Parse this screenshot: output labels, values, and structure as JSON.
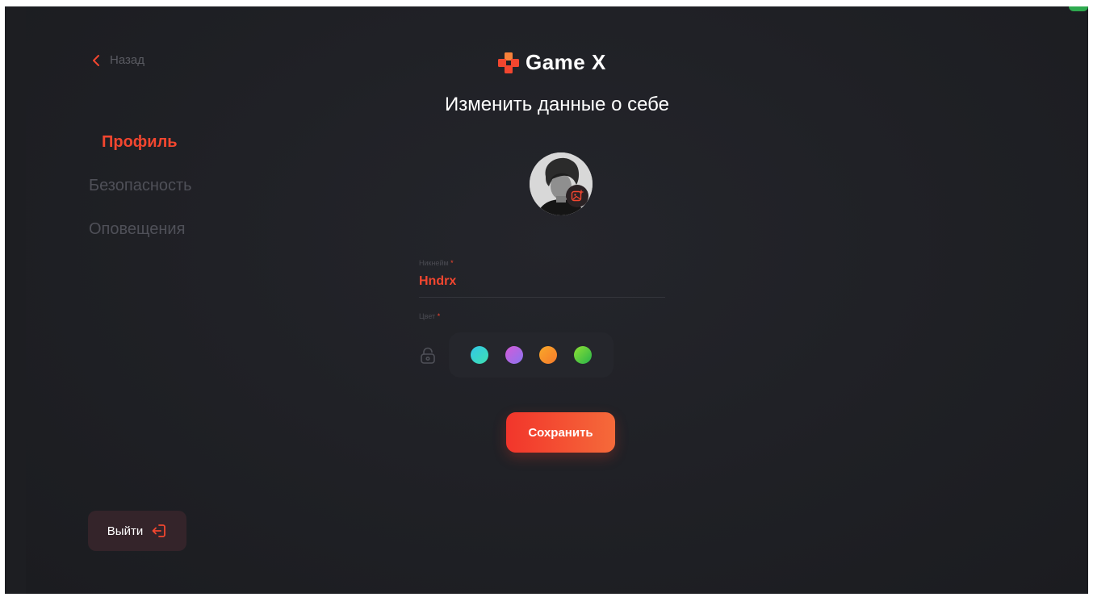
{
  "app": {
    "brand": "Game X",
    "accent_color": "#f2462f"
  },
  "header": {
    "back_label": "Назад",
    "title": "Изменить данные о себе"
  },
  "sidebar": {
    "items": [
      {
        "label": "Профиль",
        "active": true
      },
      {
        "label": "Безопасность",
        "active": false
      },
      {
        "label": "Оповещения",
        "active": false
      }
    ],
    "logout_label": "Выйти"
  },
  "form": {
    "nickname": {
      "label": "Никнейм",
      "required_mark": "*",
      "value": "Hndrx"
    },
    "color": {
      "label": "Цвет",
      "required_mark": "*"
    },
    "swatches": [
      {
        "name": "teal",
        "gradient": [
          "#32c7e8",
          "#3fe0b0"
        ]
      },
      {
        "name": "violet",
        "gradient": [
          "#d45bd8",
          "#8a74f0"
        ]
      },
      {
        "name": "orange",
        "gradient": [
          "#f9a82a",
          "#f67a2b"
        ]
      },
      {
        "name": "green",
        "gradient": [
          "#8ee034",
          "#27b44a"
        ]
      }
    ],
    "save_label": "Сохранить"
  },
  "icons": {
    "back": "chevron-left-icon",
    "logo": "gamepad-cross-icon",
    "avatar_edit": "image-edit-icon",
    "lock": "lock-icon",
    "logout": "logout-icon"
  }
}
